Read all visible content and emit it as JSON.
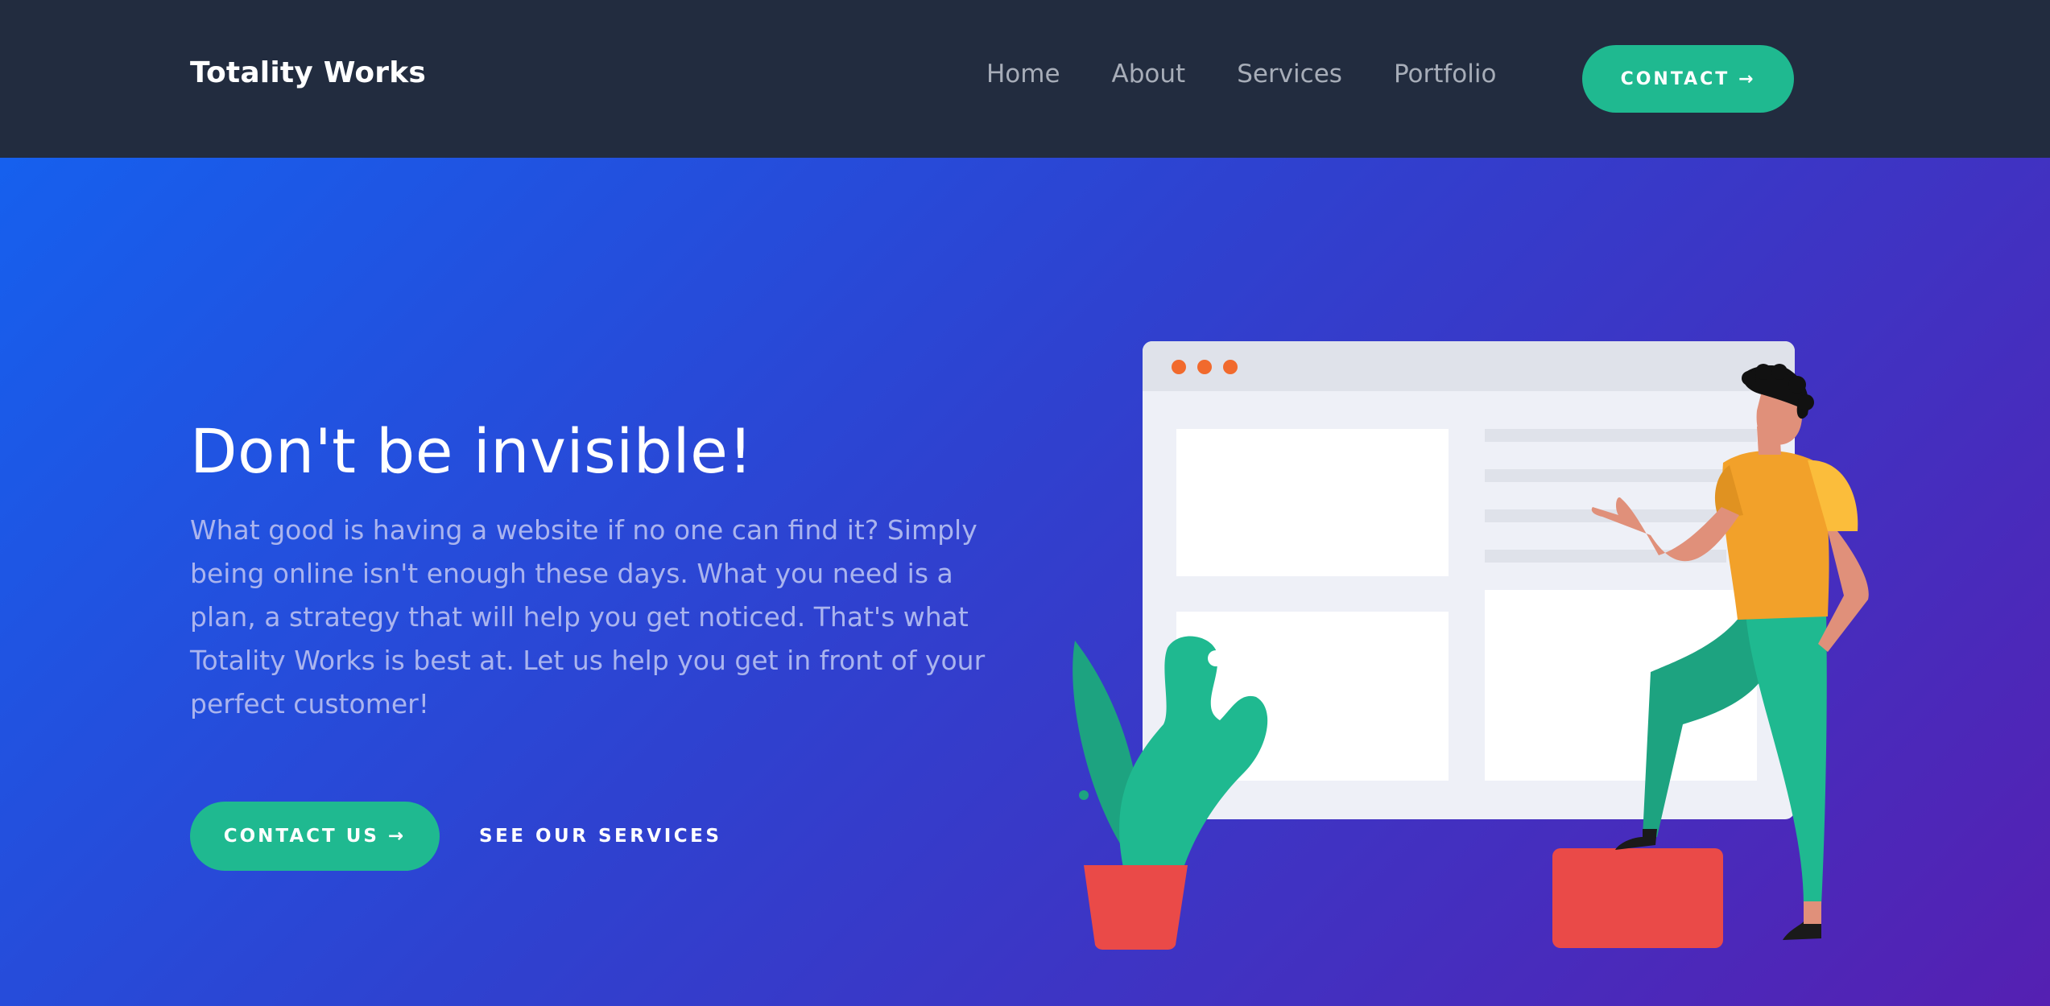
{
  "header": {
    "logo": "Totality Works",
    "nav": [
      "Home",
      "About",
      "Services",
      "Portfolio"
    ],
    "contact_button": "CONTACT →"
  },
  "hero": {
    "headline": "Don't be invisible!",
    "paragraph": "What good is having a website if no one can find it? Simply being online isn't enough these days. What you need is a plan, a strategy that will help you get noticed. That's what Totality Works is best at. Let us help you get in front of your perfect customer!",
    "primary_button": "CONTACT US →",
    "secondary_link": "SEE OUR SERVICES"
  },
  "colors": {
    "navbar": "#222c3f",
    "accent": "#1fb990",
    "hero_gradient_start": "#1660ee",
    "hero_gradient_end": "#5520b2"
  }
}
